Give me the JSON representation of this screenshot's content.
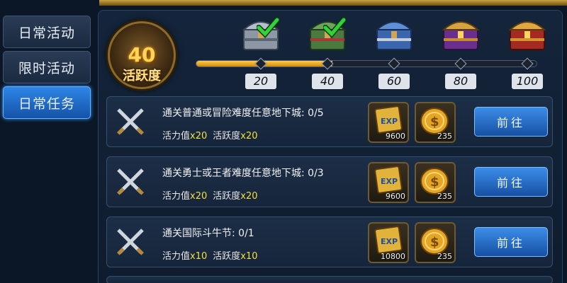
{
  "tabs": [
    {
      "label": "日常活动",
      "active": false
    },
    {
      "label": "限时活动",
      "active": false
    },
    {
      "label": "日常任务",
      "active": true
    }
  ],
  "activity": {
    "points": "40",
    "label": "活跃度",
    "progress_fraction": 0.4
  },
  "milestones": [
    {
      "value": "20",
      "claimed": true,
      "chest": "silver-chest-icon"
    },
    {
      "value": "40",
      "claimed": true,
      "chest": "green-chest-icon"
    },
    {
      "value": "60",
      "claimed": false,
      "chest": "blue-chest-icon"
    },
    {
      "value": "80",
      "claimed": false,
      "chest": "purple-chest-icon"
    },
    {
      "value": "100",
      "claimed": false,
      "chest": "red-chest-icon"
    }
  ],
  "tasks": [
    {
      "title": "通关普通或冒险难度任意地下城: 0/5",
      "vitality_label": "活力值",
      "vitality_mult": "x20",
      "activity_label": "活跃度",
      "activity_mult": "x20",
      "exp_count": "9600",
      "gold_count": "235",
      "button": "前往"
    },
    {
      "title": "通关勇士或王者难度任意地下城: 0/3",
      "vitality_label": "活力值",
      "vitality_mult": "x20",
      "activity_label": "活跃度",
      "activity_mult": "x20",
      "exp_count": "9600",
      "gold_count": "235",
      "button": "前往"
    },
    {
      "title": "通关国际斗牛节: 0/1",
      "vitality_label": "活力值",
      "vitality_mult": "x10",
      "activity_label": "活跃度",
      "activity_mult": "x10",
      "exp_count": "10800",
      "gold_count": "235",
      "button": "前往"
    }
  ],
  "colors": {
    "accent": "#2f86e6",
    "gold": "#ffcd4a",
    "multiplier": "#f2e13a"
  }
}
